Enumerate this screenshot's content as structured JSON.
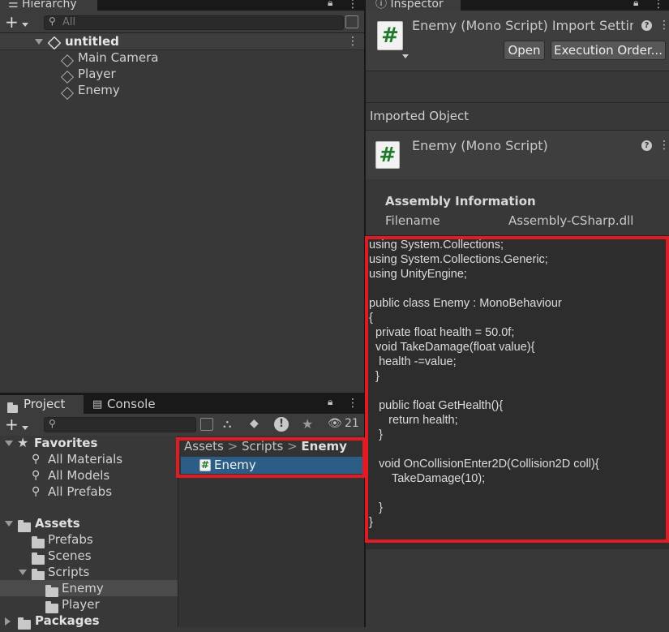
{
  "hierarchy": {
    "tab_label": "Hierarchy",
    "search_placeholder": "All",
    "scene_name": "untitled",
    "objects": [
      "Main Camera",
      "Player",
      "Enemy"
    ]
  },
  "inspector": {
    "tab_label": "Inspector",
    "header_title": "Enemy (Mono Script) Import Settin",
    "open_label": "Open",
    "execution_order_label": "Execution Order...",
    "imported_object_label": "Imported Object",
    "object_title": "Enemy (Mono Script)",
    "assembly_info_label": "Assembly Information",
    "filename_label": "Filename",
    "filename_value": "Assembly-CSharp.dll",
    "code_lines": [
      "using System.Collections;",
      "using System.Collections.Generic;",
      "using UnityEngine;",
      "",
      "public class Enemy : MonoBehaviour",
      "{",
      "  private float health = 50.0f;",
      "  void TakeDamage(float value){",
      "   health -=value;",
      "  }",
      "",
      "   public float GetHealth(){",
      "      return health;",
      "   }",
      "",
      "   void OnCollisionEnter2D(Collision2D coll){",
      "       TakeDamage(10);",
      "",
      "   }",
      "}"
    ]
  },
  "project": {
    "tabs": [
      "Project",
      "Console"
    ],
    "hidden_count": "21",
    "favorites_label": "Favorites",
    "favorites": [
      "All Materials",
      "All Models",
      "All Prefabs"
    ],
    "assets_label": "Assets",
    "asset_folders": [
      "Prefabs",
      "Scenes",
      "Scripts"
    ],
    "script_folders": [
      "Enemy",
      "Player"
    ],
    "packages_label": "Packages",
    "breadcrumb": [
      "Assets",
      "Scripts",
      "Enemy"
    ],
    "selected_file": "Enemy"
  },
  "colors": {
    "accent_selection": "#2c5d87",
    "highlight_box": "#e01b24"
  }
}
